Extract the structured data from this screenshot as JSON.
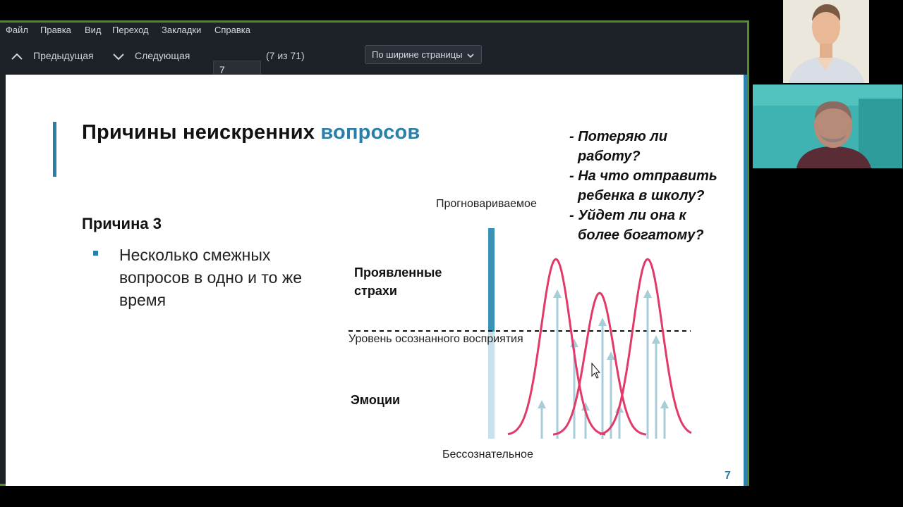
{
  "viewer": {
    "menu": [
      "Файл",
      "Правка",
      "Вид",
      "Переход",
      "Закладки",
      "Справка"
    ],
    "toolbar": {
      "prev_label": "Предыдущая",
      "next_label": "Следующая",
      "page_value": "7",
      "page_count_text": "(7 из 71)",
      "zoom_label": "По ширине страницы"
    }
  },
  "slide": {
    "title_main": "Причины неискренних ",
    "title_highlight": "вопросов",
    "reason_heading": "Причина 3",
    "bullet": "Несколько смежных вопросов в одно и то же время",
    "questions": [
      "- Потеряю ли",
      "работу?",
      "- На что отправить",
      "ребенка в школу?",
      "- Уйдет ли она к",
      "более богатому?"
    ],
    "diagram": {
      "top_label": "Прогновариваемое",
      "manifest_fears": "Проявленные страхи",
      "awareness_level": "Уровень осознанного восприятия",
      "emotions": "Эмоции",
      "bottom_label": "Бессознательное"
    },
    "page_number": "7"
  },
  "colors": {
    "accent": "#2a7fa8",
    "curve": "#e23a68",
    "arrow": "#a8ccd8",
    "frame": "#4e8f2a"
  }
}
